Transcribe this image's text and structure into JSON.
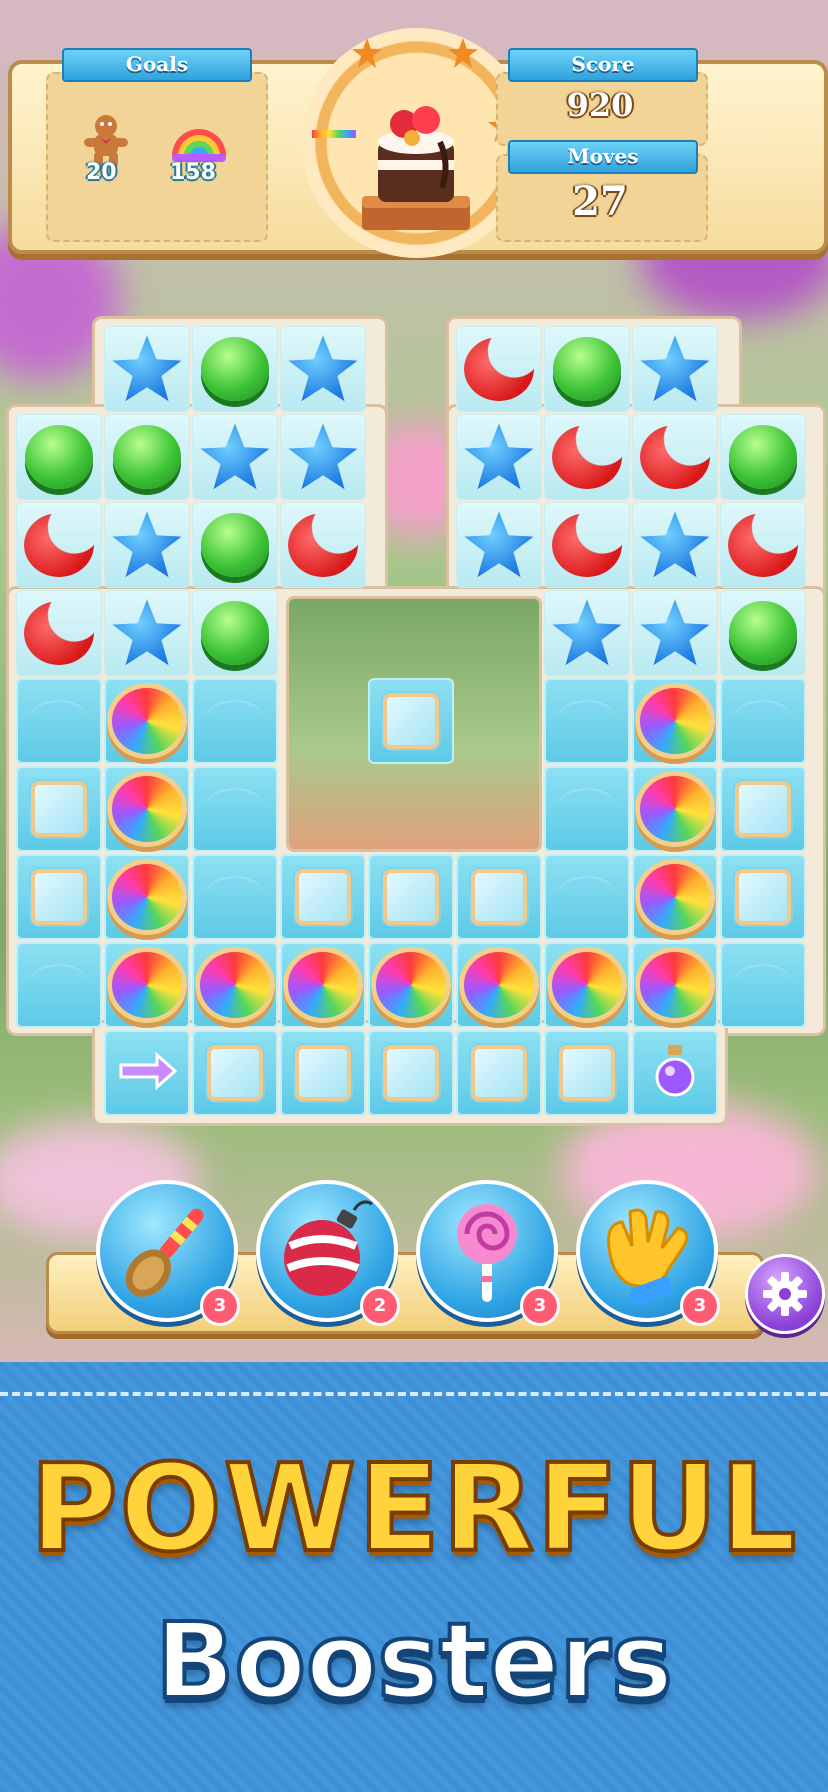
{
  "hud": {
    "goals_label": "Goals",
    "goals": [
      {
        "icon": "gingerbread-icon",
        "count": "20"
      },
      {
        "icon": "rainbow-cookie-icon",
        "count": "158"
      }
    ],
    "score_label": "Score",
    "score_value": "920",
    "moves_label": "Moves",
    "moves_value": "27",
    "level_target": "cake-icon"
  },
  "boosters": [
    {
      "name": "spoon-booster",
      "icon": "spoon-icon",
      "count": "3"
    },
    {
      "name": "bomb-booster",
      "icon": "bomb-icon",
      "count": "2"
    },
    {
      "name": "lollipop-booster",
      "icon": "lollipop-icon",
      "count": "3"
    },
    {
      "name": "glove-booster",
      "icon": "glove-icon",
      "count": "3"
    }
  ],
  "settings_icon": "gear-icon",
  "banner": {
    "line1": "POWERFUL",
    "line2": "Boosters"
  },
  "colors": {
    "banner_blue": "#3f8fd6",
    "title_gold": "#ffd43a",
    "ribbon_blue": "#2fa2dd"
  }
}
